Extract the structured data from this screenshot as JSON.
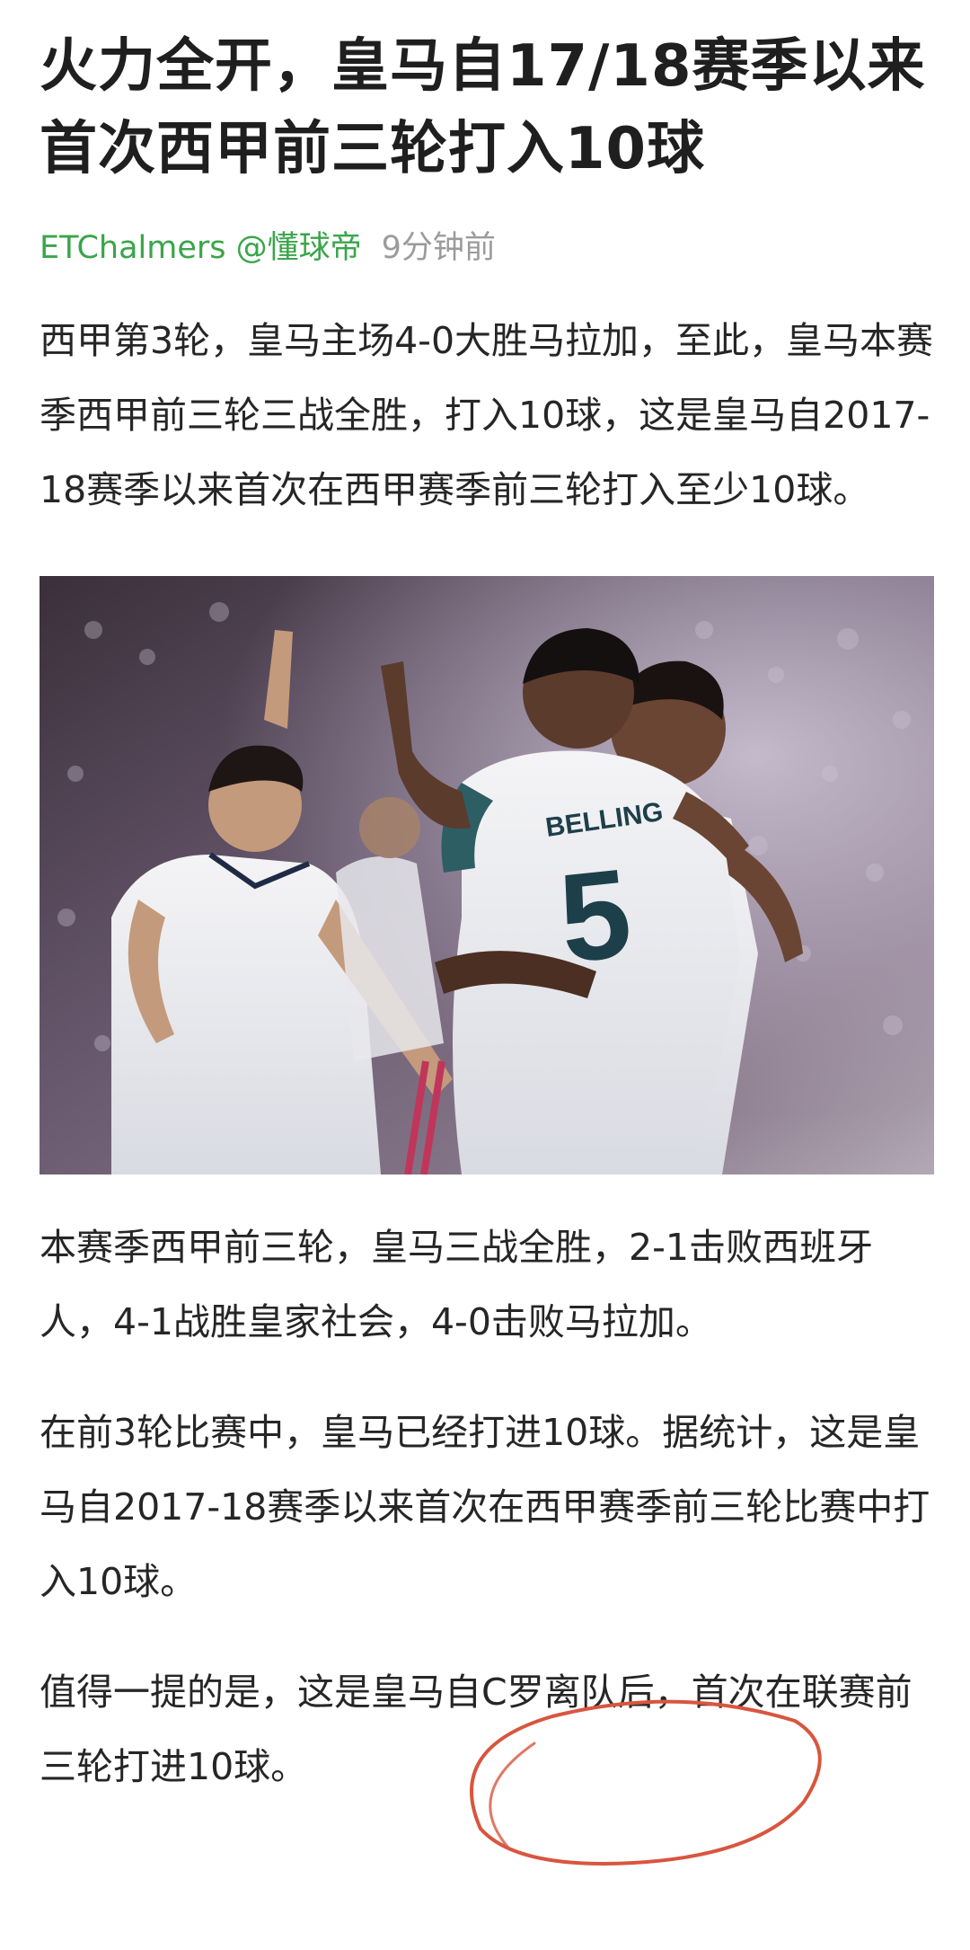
{
  "article": {
    "title": "火力全开，皇马自17/18赛季以来首次西甲前三轮打入10球",
    "author": "ETChalmers @懂球帝",
    "time": "9分钟前",
    "paragraphs": [
      "西甲第3轮，皇马主场4-0大胜马拉加，至此，皇马本赛季西甲前三轮三战全胜，打入10球，这是皇马自2017-18赛季以来首次在西甲赛季前三轮打入至少10球。",
      "本赛季西甲前三轮，皇马三战全胜，2-1击败西班牙人，4-1战胜皇家社会，4-0击败马拉加。",
      "在前3轮比赛中，皇马已经打进10球。据统计，这是皇马自2017-18赛季以来首次在西甲赛季前三轮比赛中打入10球。",
      "值得一提的是，这是皇马自C罗离队后，首次在联赛前三轮打进10球。"
    ],
    "photo": {
      "jersey_name": "BELLING",
      "jersey_number": "5"
    }
  },
  "colors": {
    "author": "#3aa54a",
    "time": "#9b9b9b",
    "annotation": "#d9553f"
  }
}
